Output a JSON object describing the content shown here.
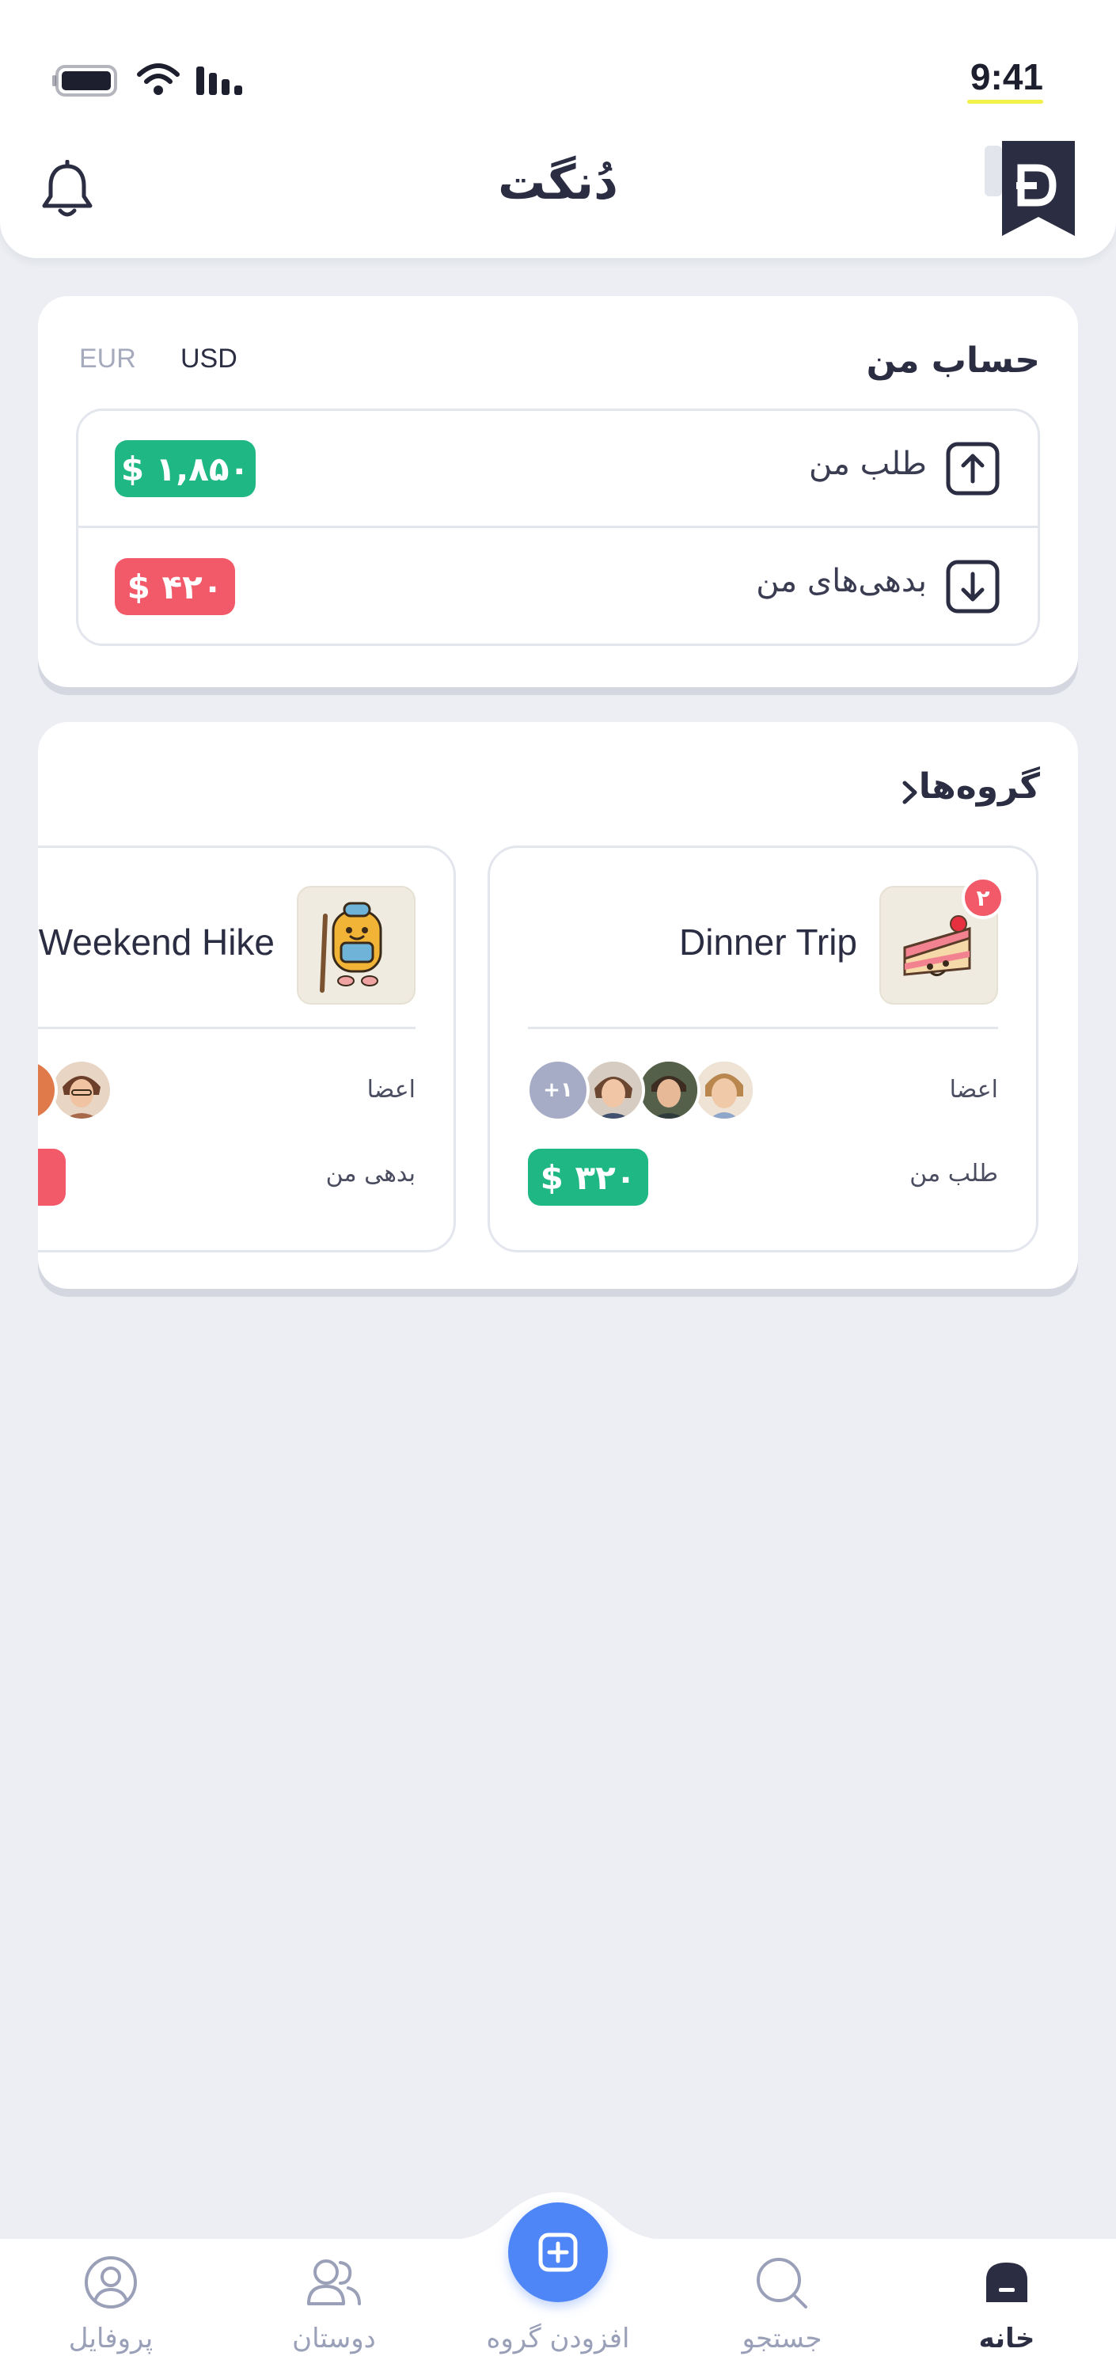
{
  "status_bar": {
    "time": "9:41"
  },
  "header": {
    "title": "دُنگت"
  },
  "account": {
    "title": "حساب من",
    "currencies": [
      "USD",
      "EUR"
    ],
    "selected_currency": "USD",
    "receivable_label": "طلب من",
    "receivable_amount": "$ ۱,۸۵۰",
    "debt_label": "بدهی‌های من",
    "debt_amount": "$ ۴۲۰"
  },
  "groups": {
    "title": "گروه‌ها",
    "items": [
      {
        "name": "Dinner Trip",
        "badge": "۲",
        "members_label": "اعضا",
        "extra_members": "+۱",
        "balance_label": "طلب من",
        "balance_amount": "$ ۳۲۰",
        "balance_type": "receivable"
      },
      {
        "name": "Weekend Hike",
        "members_label": "اعضا",
        "balance_label": "بدهی من",
        "balance_type": "debt"
      }
    ]
  },
  "bottom_nav": {
    "items": [
      {
        "label": "خانه",
        "icon": "home-icon",
        "active": true
      },
      {
        "label": "جستجو",
        "icon": "search-icon",
        "active": false
      },
      {
        "label": "افزودن گروه",
        "icon": "add-icon",
        "active": false
      },
      {
        "label": "دوستان",
        "icon": "friends-icon",
        "active": false
      },
      {
        "label": "پروفایل",
        "icon": "profile-icon",
        "active": false
      }
    ]
  },
  "colors": {
    "background": "#eceef3",
    "positive": "#1fb884",
    "negative": "#f25a6a",
    "accent": "#4f86f7",
    "text": "#2b2d42"
  }
}
